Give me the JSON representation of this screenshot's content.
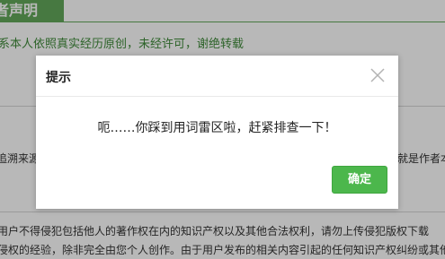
{
  "background": {
    "header_tab_text": "者声明",
    "statement": "系本人依照真实经历原创，未经许可，谢绝转载",
    "row1_left": "追溯来源",
    "row1_right": "就是作者本",
    "para_line1": "用户不得侵犯包括他人的著作权在内的知识产权以及其他合法权利，请勿上传侵犯版权下载",
    "para_line2": "侵权的经验，除非完全由您个人创作。由于用户发布的相关内容引起的任何知识产权纠纷或其他"
  },
  "dialog": {
    "title": "提示",
    "close_icon": "close-icon",
    "message": "呃……你踩到用词雷区啦，赶紧排查一下！",
    "confirm_label": "确定"
  },
  "colors": {
    "brand_green": "#63a85b",
    "confirm_green": "#4cb74c"
  }
}
